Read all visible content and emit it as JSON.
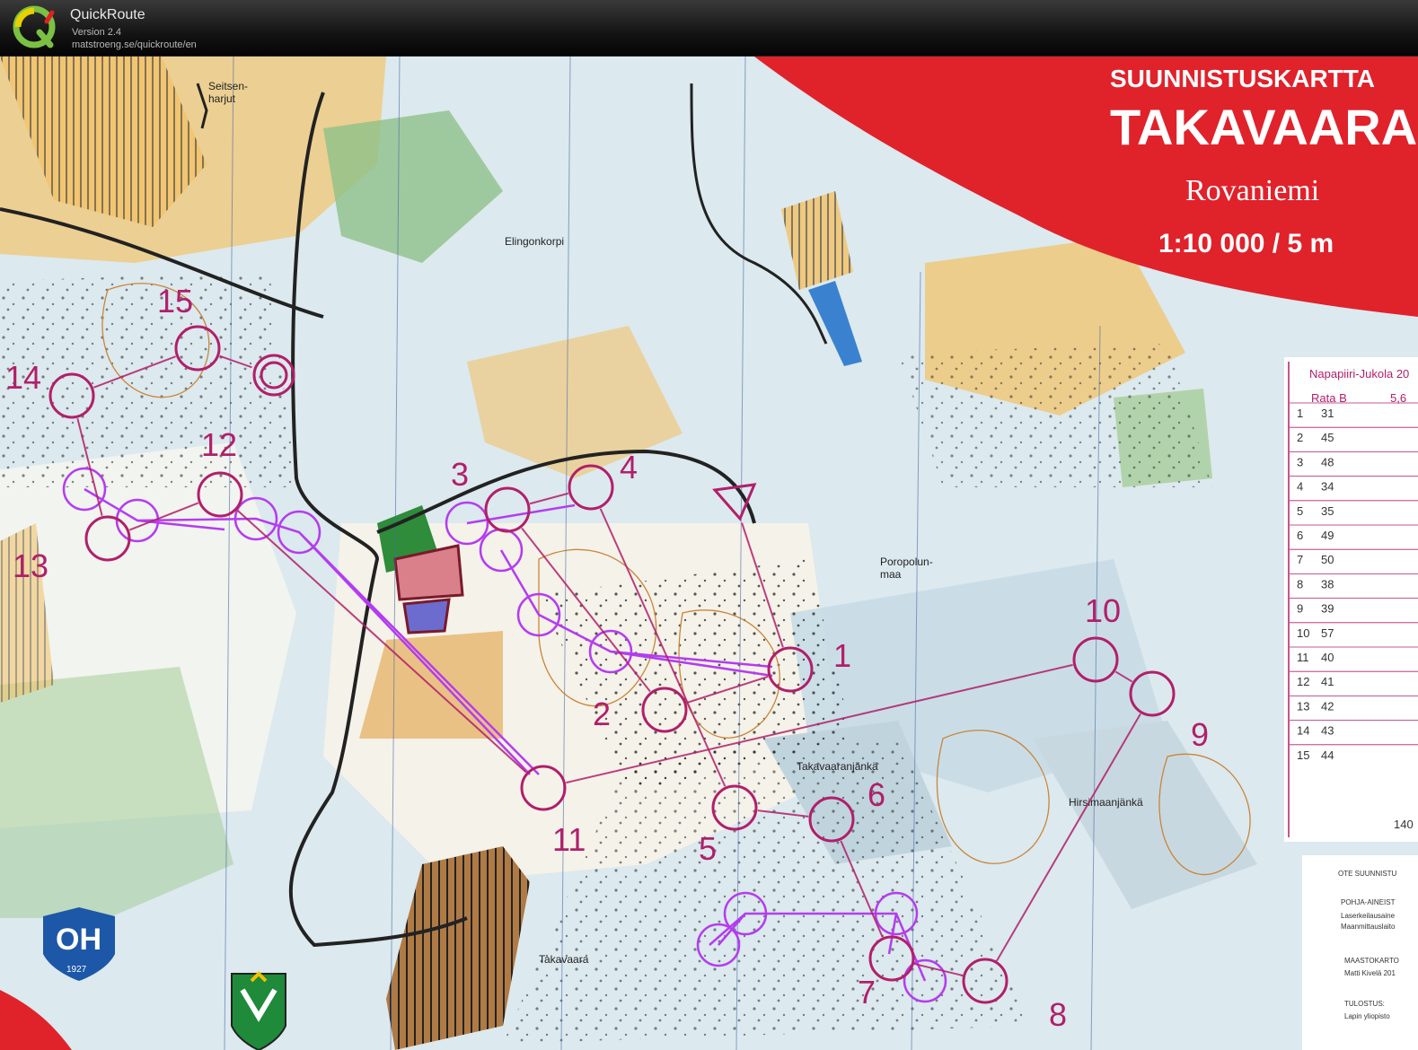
{
  "app": {
    "name": "QuickRoute",
    "version": "Version 2.4",
    "url": "matstroeng.se/quickroute/en"
  },
  "map": {
    "header_top": "SUUNNISTUSKARTTA",
    "header_name": "TAKAVAARA",
    "city": "Rovaniemi",
    "scale": "1:10 000  /  5 m",
    "place_names": [
      {
        "id": "seitsenharjut",
        "lines": [
          "Seitsen-",
          "harjut"
        ]
      },
      {
        "id": "elingonkorpi",
        "lines": [
          "Elingonkorpi"
        ]
      },
      {
        "id": "poropolunmaa",
        "lines": [
          "Poropolun-",
          "maa"
        ]
      },
      {
        "id": "takavaaranjanka",
        "lines": [
          "Takavaaranjänkä"
        ]
      },
      {
        "id": "hirsimaanjanka",
        "lines": [
          "Hirsimaanjänkä"
        ]
      },
      {
        "id": "takavaara",
        "lines": [
          "Takavaara"
        ]
      }
    ],
    "control_numbers": [
      "1",
      "2",
      "3",
      "4",
      "5",
      "6",
      "7",
      "8",
      "9",
      "10",
      "11",
      "12",
      "13",
      "14",
      "15"
    ],
    "club_logo_text": "OH",
    "club_logo_year": "1927",
    "course_table": {
      "event": "Napapiiri-Jukola 20",
      "course": "Rata B",
      "length": "5,6",
      "rows": [
        {
          "n": "1",
          "code": "31"
        },
        {
          "n": "2",
          "code": "45"
        },
        {
          "n": "3",
          "code": "48"
        },
        {
          "n": "4",
          "code": "34"
        },
        {
          "n": "5",
          "code": "35"
        },
        {
          "n": "6",
          "code": "49"
        },
        {
          "n": "7",
          "code": "50"
        },
        {
          "n": "8",
          "code": "38"
        },
        {
          "n": "9",
          "code": "39"
        },
        {
          "n": "10",
          "code": "57"
        },
        {
          "n": "11",
          "code": "40"
        },
        {
          "n": "12",
          "code": "41"
        },
        {
          "n": "13",
          "code": "42"
        },
        {
          "n": "14",
          "code": "43"
        },
        {
          "n": "15",
          "code": "44"
        }
      ],
      "finish_value": "140"
    },
    "credits": {
      "ote": "OTE SUUNNISTU",
      "pohja": "POHJA-AINEIST",
      "laser": "Laserkeilausaine",
      "maanmitt": "Maanmittauslaito",
      "maastokartoitus": "MAASTOKARTO",
      "mapper": "Matti Kivelä 201",
      "tulostus": "TULOSTUS:",
      "printer": "Lapin yliopisto"
    },
    "colors": {
      "course_magenta": "#b11f6a",
      "route_purple": "#b43cf0",
      "forest_green": "#4e9a3a",
      "open_yellow": "#f2c36b",
      "header_red": "#e0222b"
    }
  }
}
